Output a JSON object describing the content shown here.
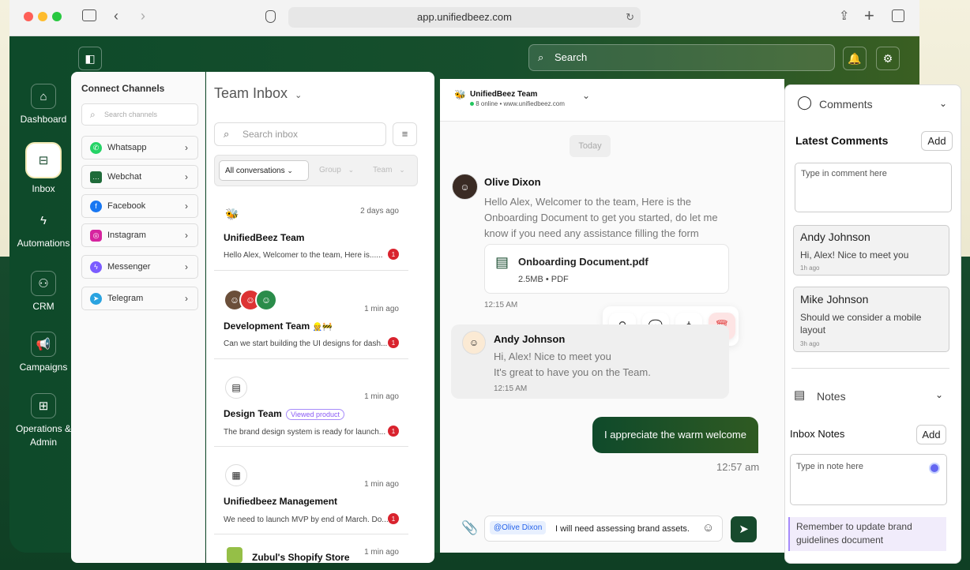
{
  "browser": {
    "url": "app.unifiedbeez.com"
  },
  "topbar": {
    "search_placeholder": "Search"
  },
  "sidebar": {
    "items": [
      {
        "label": "Dashboard"
      },
      {
        "label": "Inbox"
      },
      {
        "label": "Automations"
      },
      {
        "label": "CRM"
      },
      {
        "label": "Campaigns"
      },
      {
        "label": "Operations &"
      },
      {
        "label": "Admin"
      }
    ]
  },
  "channels": {
    "title": "Connect Channels",
    "search_placeholder": "Search channels",
    "items": [
      {
        "label": "Whatsapp",
        "color": "#25d366"
      },
      {
        "label": "Webchat",
        "color": "#1f6b3a"
      },
      {
        "label": "Facebook",
        "color": "#1877f2"
      },
      {
        "label": "Instagram",
        "color": "#d6249f"
      },
      {
        "label": "Messenger",
        "color": "#7b5cff"
      },
      {
        "label": "Telegram",
        "color": "#2aa3e0"
      }
    ]
  },
  "inbox": {
    "title": "Team Inbox",
    "search_placeholder": "Search inbox",
    "filters": [
      "All conversations",
      "Group",
      "Team"
    ],
    "conversations": [
      {
        "name": "UnifiedBeez Team",
        "preview": "Hello Alex, Welcomer to the team, Here is......",
        "time": "2 days ago",
        "unread": "1"
      },
      {
        "name": "Development Team",
        "preview": "Can we start building the UI designs for dash...",
        "time": "1 min ago",
        "unread": "1"
      },
      {
        "name": "Design Team",
        "tag": "Viewed product",
        "preview": "The brand design system is ready for launch...",
        "time": "1 min ago",
        "unread": "1"
      },
      {
        "name": "Unifiedbeez Management",
        "preview": "We need to launch MVP by end of March. Do...",
        "time": "1 min ago",
        "unread": "1"
      },
      {
        "name": "Zubul's Shopify Store",
        "time": "1 min ago"
      }
    ]
  },
  "chat": {
    "header": {
      "name": "UnifiedBeez Team",
      "status": "8 online • www.unifiedbeez.com"
    },
    "day": "Today",
    "msg1": {
      "sender": "Olive Dixon",
      "lines": [
        "Hello Alex, Welcomer to the team, Here is the",
        "Onboarding Document to get you started, do let me",
        "know if you need any assistance filling the form"
      ],
      "file_name": "Onboarding Document.pdf",
      "file_meta": "2.5MB • PDF",
      "time": "12:15 AM"
    },
    "msg2": {
      "sender": "Andy Johnson",
      "lines": [
        "Hi, Alex! Nice to meet you",
        "It's great to have you on the Team."
      ],
      "time": "12:15 AM"
    },
    "msg3": {
      "text": "I appreciate the warm welcome",
      "time": "12:57 am"
    },
    "composer": {
      "mention": "@Olive Dixon",
      "text": "I will need assessing brand assets."
    }
  },
  "comments": {
    "title": "Comments",
    "latest_title": "Latest Comments",
    "add_label": "Add",
    "placeholder": "Type in comment here",
    "items": [
      {
        "author": "Andy Johnson",
        "text": "Hi, Alex! Nice to meet you",
        "time": "1h ago"
      },
      {
        "author": "Mike Johnson",
        "text": "Should we consider a mobile layout",
        "time": "3h ago"
      }
    ]
  },
  "notes": {
    "title": "Notes",
    "inbox_title": "Inbox Notes",
    "add_label": "Add",
    "placeholder": "Type in note here",
    "reminder": "Remember to update brand guidelines document"
  }
}
